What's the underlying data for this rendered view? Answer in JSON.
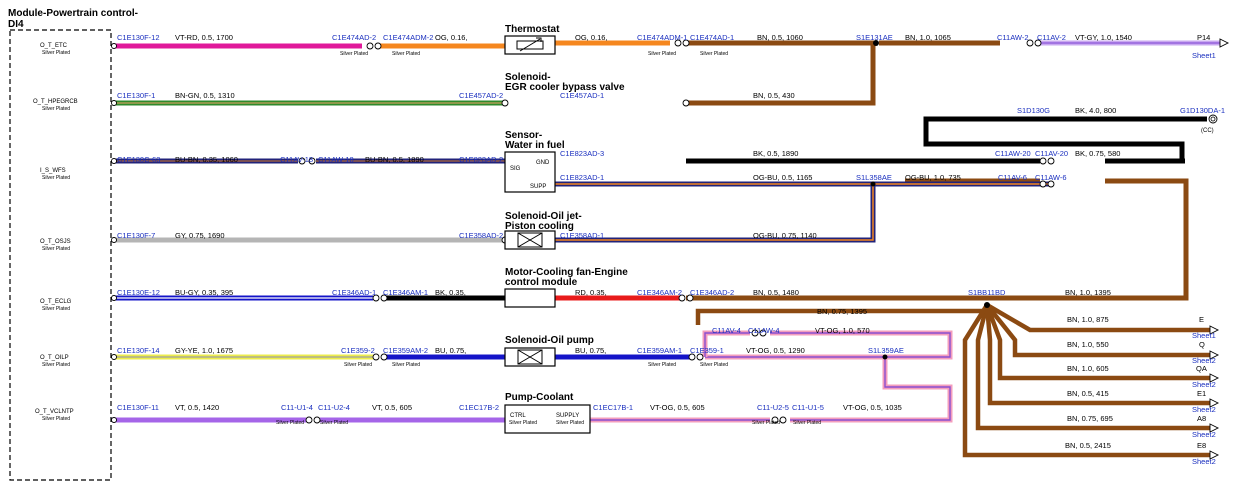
{
  "module": {
    "title": "Module-Powertrain control-",
    "subtitle": "DI4",
    "pins": [
      {
        "name": "O_T_ETC",
        "plating": "Silver Plated"
      },
      {
        "name": "O_T_HPEGRCB",
        "plating": "Silver Plated"
      },
      {
        "name": "I_S_WFS",
        "plating": "Silver Plated"
      },
      {
        "name": "O_T_OSJS",
        "plating": "Silver Plated"
      },
      {
        "name": "O_T_ECLG",
        "plating": "Silver Plated"
      },
      {
        "name": "O_T_OILP",
        "plating": "Silver Plated"
      },
      {
        "name": "O_T_VCLNTP",
        "plating": "Silver Plated"
      }
    ]
  },
  "components": {
    "thermostat": {
      "title": "Thermostat"
    },
    "egr": {
      "title1": "Solenoid-",
      "title2": "EGR cooler bypass valve"
    },
    "water": {
      "title1": "Sensor-",
      "title2": "Water in fuel",
      "pin_gnd": "GND",
      "pin_sig": "SIG",
      "pin_supp": "SUPP"
    },
    "oiljet": {
      "title1": "Solenoid-Oil jet-",
      "title2": "Piston cooling"
    },
    "fan": {
      "title1": "Motor-Cooling fan-Engine",
      "title2": "control module"
    },
    "oilpump": {
      "title": "Solenoid-Oil pump"
    },
    "coolant": {
      "title": "Pump-Coolant",
      "pin_ctrl": "CTRL",
      "pin_supply": "SUPPLY",
      "plating1": "Silver Plated",
      "plating2": "Silver Plated"
    }
  },
  "wires": {
    "r1": {
      "c1": "C1E130F-12",
      "w1": "VT-RD, 0.5, 1700",
      "c2": "C1E474AD-2",
      "c3": "C1E474ADM-2",
      "w2": "OG, 0.16,",
      "w3": "OG, 0.16,",
      "c4": "C1E474ADM-1",
      "c5": "C1E474AD-1",
      "w4": "BN, 0.5, 1060",
      "splice": "S1E131AE",
      "w5": "BN, 1.0, 1065",
      "c6": "C11AW-2",
      "c7": "C11AV-2",
      "w6": "VT-GY, 1.0, 1540",
      "dest": "P14",
      "sheet": "Sheet1",
      "sp1": "Silver Plated",
      "sp2": "Silver Plated",
      "sp3": "Silver Plated",
      "sp4": "Silver Plated"
    },
    "r2": {
      "c1": "C1E130F-1",
      "w1": "BN-GN, 0.5, 1310",
      "c2": "C1E457AD-2",
      "c3": "C1E457AD-1",
      "w2": "BN, 0.5, 430"
    },
    "gnd": {
      "splice": "S1D130G",
      "w1": "BK, 4.0, 800",
      "dest": "G1D130DA-1",
      "cc": "(CC)"
    },
    "r3": {
      "c1": "C1E130C-63",
      "w1": "BU-BN, 0.35, 1060",
      "c2": "C11AV-18",
      "c3": "C11AW-18",
      "w2": "BU-BN, 0.5, 1890",
      "c4": "C1E823AD-2",
      "c5": "C1E823AD-3",
      "w3": "BK, 0.5, 1890",
      "c6": "C11AW-20",
      "c7": "C11AV-20",
      "w4": "BK, 0.75, 580"
    },
    "r3b": {
      "c1": "C1E823AD-1",
      "w1": "OG-BU, 0.5, 1165",
      "splice": "S1L358AE",
      "w2": "OG-BU, 1.0, 735",
      "c2": "C11AV-6",
      "c3": "C11AW-6"
    },
    "r4": {
      "c1": "C1E130F-7",
      "w1": "GY, 0.75, 1690",
      "c2": "C1E358AD-2",
      "c3": "C1E358AD-1",
      "w2": "OG-BU, 0.75, 1140"
    },
    "r5": {
      "c1": "C1E130E-12",
      "w1": "BU-GY, 0.35, 395",
      "c2": "C1E346AD-1",
      "c3": "C1E346AM-1",
      "w2": "BK, 0.35,",
      "w3": "RD, 0.35,",
      "c4": "C1E346AM-2",
      "c5": "C1E346AD-2",
      "w4": "BN, 0.5, 1480",
      "splice": "S1BB11BD",
      "w5": "BN, 1.0, 1395"
    },
    "r5b": {
      "w1": "BN, 0.75, 1395",
      "c1": "C11AV-4",
      "c2": "C11AW-4",
      "w2": "VT-OG, 1.0, 570"
    },
    "r6": {
      "c1": "C1E130F-14",
      "w1": "GY-YE, 1.0, 1675",
      "c2": "C1E359-2",
      "c3": "C1E359AM-2",
      "w2": "BU, 0.75,",
      "w3": "BU, 0.75,",
      "c4": "C1E359AM-1",
      "c5": "C1E359-1",
      "w4": "VT-OG, 0.5, 1290",
      "splice": "S1L359AE",
      "sp1": "Silver Plated",
      "sp2": "Silver Plated",
      "sp3": "Silver Plated",
      "sp4": "Silver Plated"
    },
    "r7": {
      "c1": "C1E130F-11",
      "w1": "VT, 0.5, 1420",
      "c2": "C11-U1-4",
      "c3": "C11-U2-4",
      "w2": "VT, 0.5, 605",
      "c4": "C1EC17B-2",
      "c5": "C1EC17B-1",
      "w3": "VT-OG, 0.5, 605",
      "c6": "C11-U2-5",
      "c7": "C11-U1-5",
      "w4": "VT-OG, 0.5, 1035",
      "sp1": "Silver Plated",
      "sp2": "Silver Plated",
      "sp3": "Silver Plated",
      "sp4": "Silver Plated"
    }
  },
  "branches": [
    {
      "wire": "BN, 1.0, 875",
      "dest": "E",
      "sheet": "Sheet1"
    },
    {
      "wire": "BN, 1.0, 550",
      "dest": "Q",
      "sheet": "Sheet2"
    },
    {
      "wire": "BN, 1.0, 605",
      "dest": "QA",
      "sheet": "Sheet2"
    },
    {
      "wire": "BN, 0.5, 415",
      "dest": "E1",
      "sheet": "Sheet2"
    },
    {
      "wire": "BN, 0.75, 695",
      "dest": "A8",
      "sheet": "Sheet2"
    },
    {
      "wire": "BN, 0.5, 2415",
      "dest": "E8",
      "sheet": "Sheet2"
    }
  ],
  "colors": {
    "brown": "#8b4a12",
    "magenta": "#e0199a",
    "orange": "#f5871f",
    "green": "#2f8a2c",
    "black": "#000000",
    "navy": "#22237a",
    "gray": "#b5b5b5",
    "blue": "#1414c8",
    "red": "#e81b1b",
    "yellow": "#ecec4c",
    "violet": "#a565e8",
    "pink": "#f39dbd",
    "lavender": "#c9a8f0",
    "label_blue": "#1a2fbf"
  }
}
